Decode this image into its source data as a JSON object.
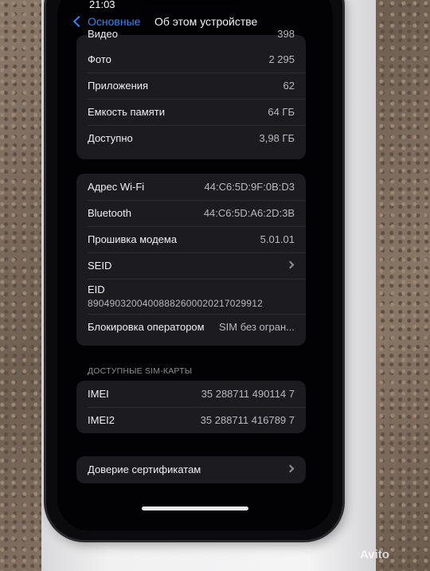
{
  "status_bar": {
    "time": "21:03"
  },
  "nav": {
    "back_label": "Основные",
    "title": "Об этом устройстве"
  },
  "storage_group": [
    {
      "label": "Видео",
      "value": "398"
    },
    {
      "label": "Фото",
      "value": "2 295"
    },
    {
      "label": "Приложения",
      "value": "62"
    },
    {
      "label": "Емкость памяти",
      "value": "64 ГБ"
    },
    {
      "label": "Доступно",
      "value": "3,98 ГБ"
    }
  ],
  "network_group": {
    "wifi": {
      "label": "Адрес Wi-Fi",
      "value": "44:C6:5D:9F:0B:D3"
    },
    "bluetooth": {
      "label": "Bluetooth",
      "value": "44:C6:5D:A6:2D:3B"
    },
    "modem": {
      "label": "Прошивка модема",
      "value": "5.01.01"
    },
    "seid": {
      "label": "SEID"
    },
    "eid": {
      "label": "EID",
      "value": "89049032004008882600020217029912"
    },
    "carrier_lock": {
      "label": "Блокировка оператором",
      "value": "SIM без огран..."
    }
  },
  "sim_section": {
    "header": "ДОСТУПНЫЕ SIM-КАРТЫ",
    "imei": {
      "label": "IMEI",
      "value": "35 288711 490114 7"
    },
    "imei2": {
      "label": "IMEI2",
      "value": "35 288711 416789 7"
    }
  },
  "certificates": {
    "label": "Доверие сертификатам"
  },
  "watermark": "Avito"
}
